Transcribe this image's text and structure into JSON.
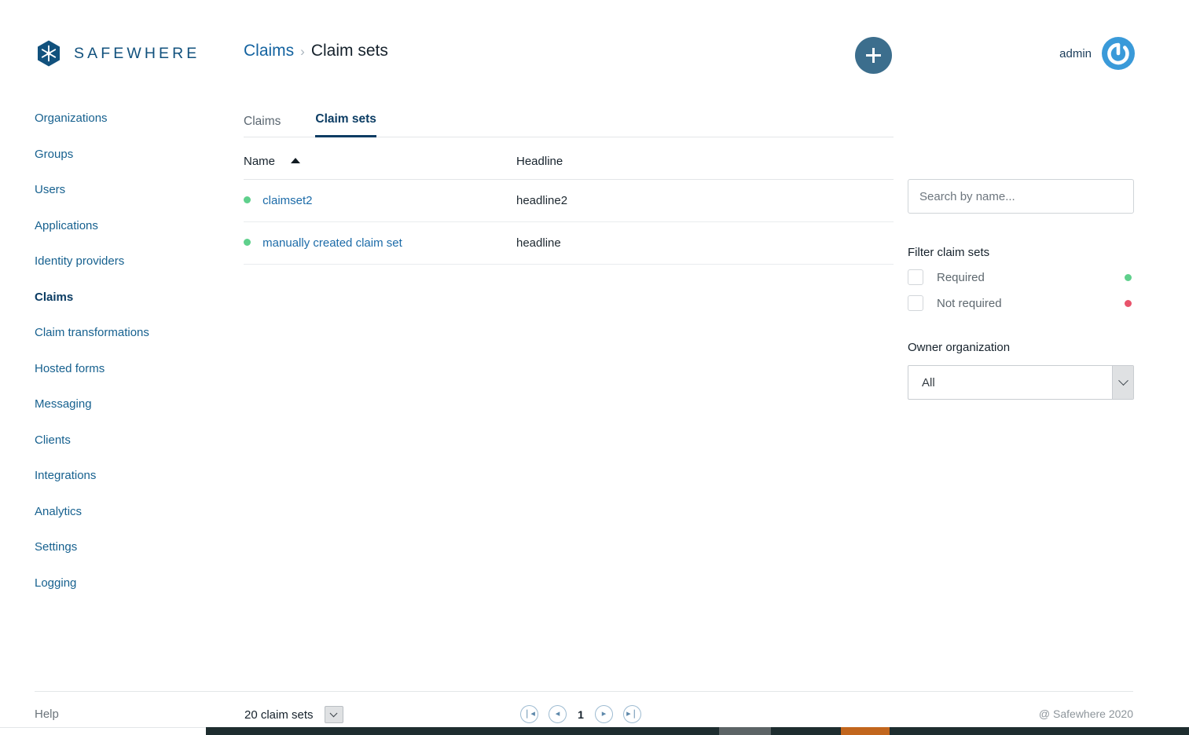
{
  "brand": {
    "name": "SAFEWHERE",
    "logo_icon": "hexagon-snowflake-icon",
    "logo_color": "#11517d"
  },
  "header": {
    "breadcrumb": {
      "parent": "Claims",
      "separator": "›",
      "current": "Claim sets"
    },
    "add_button": {
      "icon": "plus-icon",
      "label": "+",
      "color": "#3c6e8d"
    },
    "user": {
      "name": "admin",
      "avatar_icon": "power-avatar-icon",
      "avatar_color": "#3a9ad9"
    }
  },
  "sidebar": {
    "items": [
      {
        "label": "Organizations",
        "active": false
      },
      {
        "label": "Groups",
        "active": false
      },
      {
        "label": "Users",
        "active": false
      },
      {
        "label": "Applications",
        "active": false
      },
      {
        "label": "Identity providers",
        "active": false
      },
      {
        "label": "Claims",
        "active": true
      },
      {
        "label": "Claim transformations",
        "active": false
      },
      {
        "label": "Hosted forms",
        "active": false
      },
      {
        "label": "Messaging",
        "active": false
      },
      {
        "label": "Clients",
        "active": false
      },
      {
        "label": "Integrations",
        "active": false
      },
      {
        "label": "Analytics",
        "active": false
      },
      {
        "label": "Settings",
        "active": false
      },
      {
        "label": "Logging",
        "active": false
      }
    ]
  },
  "main": {
    "tabs": [
      {
        "label": "Claims",
        "active": false
      },
      {
        "label": "Claim sets",
        "active": true
      }
    ],
    "table": {
      "columns": [
        {
          "label": "Name",
          "sort": "asc",
          "sort_icon": "sort-ascending-icon"
        },
        {
          "label": "Headline",
          "sort": "none"
        }
      ],
      "rows": [
        {
          "status": "required",
          "status_color": "#5fd08c",
          "name": "claimset2",
          "headline": "headline2"
        },
        {
          "status": "required",
          "status_color": "#5fd08c",
          "name": "manually created claim set",
          "headline": "headline"
        }
      ]
    }
  },
  "filters": {
    "search": {
      "value": "",
      "placeholder": "Search by name..."
    },
    "title": "Filter claim sets",
    "checkboxes": [
      {
        "label": "Required",
        "checked": false,
        "dot_color": "#5fd08c"
      },
      {
        "label": "Not required",
        "checked": false,
        "dot_color": "#e8536b"
      }
    ],
    "owner_org": {
      "title": "Owner organization",
      "selected": "All",
      "options": [
        "All"
      ]
    }
  },
  "footer": {
    "help": "Help",
    "count": "20 claim sets",
    "pagination": {
      "first_icon": "first-page-icon",
      "first_label": "❘◂",
      "prev_icon": "previous-page-icon",
      "prev_label": "◂",
      "page": "1",
      "next_icon": "next-page-icon",
      "next_label": "▸",
      "last_icon": "last-page-icon",
      "last_label": "▸❘"
    },
    "copyright": "@ Safewhere 2020"
  }
}
